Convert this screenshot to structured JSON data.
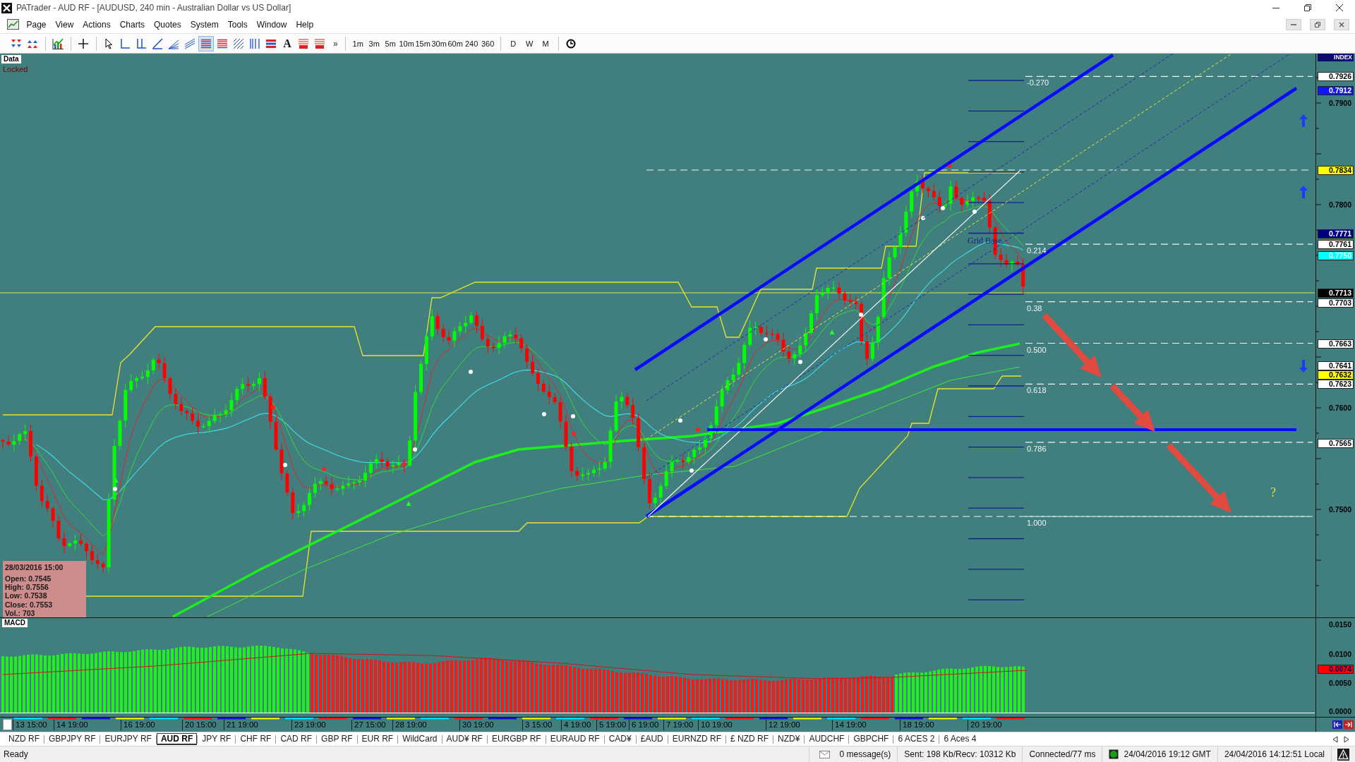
{
  "window": {
    "title": "PATrader - AUD RF - [AUDUSD, 240 min - Australian Dollar vs US Dollar]"
  },
  "menu": [
    "Page",
    "View",
    "Actions",
    "Charts",
    "Quotes",
    "System",
    "Tools",
    "Window",
    "Help"
  ],
  "toolbar": {
    "tool_groups": [
      [
        {
          "kind": "scroll-down",
          "selected": false
        },
        {
          "kind": "scroll-up",
          "selected": false
        }
      ],
      [
        {
          "kind": "indicators",
          "selected": false
        }
      ],
      [
        {
          "kind": "crosshair",
          "selected": false
        }
      ],
      [
        {
          "kind": "cursor",
          "selected": false
        },
        {
          "kind": "angle",
          "selected": false
        },
        {
          "kind": "double-angle",
          "selected": false
        },
        {
          "kind": "trendline",
          "selected": false
        },
        {
          "kind": "fan",
          "selected": false
        },
        {
          "kind": "parallel",
          "selected": false
        },
        {
          "kind": "fib-levels",
          "selected": true
        },
        {
          "kind": "levels",
          "selected": false
        },
        {
          "kind": "hatch",
          "selected": false
        },
        {
          "kind": "vertical",
          "selected": false
        },
        {
          "kind": "stripes",
          "selected": false
        },
        {
          "kind": "text",
          "label": "A",
          "selected": false
        },
        {
          "kind": "tagged-lines",
          "selected": false
        },
        {
          "kind": "tagged-lines",
          "selected": false
        }
      ]
    ],
    "overflow": "»",
    "periods": [
      "1m",
      "3m",
      "5m",
      "10m",
      "15m",
      "30m",
      "60m",
      "240",
      "360"
    ],
    "chart_periods": [
      "D",
      "W",
      "M"
    ]
  },
  "chart": {
    "data_label": "Data",
    "lock_status": "Locked",
    "price_axis": {
      "header": "INDEX",
      "labels": [
        {
          "text": "0.7926",
          "kind": "marker",
          "color": "#ffffff",
          "light_text": false
        },
        {
          "text": "0.7912",
          "kind": "marker",
          "color": "#1414ff",
          "light_text": true
        },
        {
          "text": "0.7900",
          "kind": "tick"
        },
        {
          "text": "0.7834",
          "kind": "marker",
          "color": "#ffff00",
          "light_text": false
        },
        {
          "text": "0.7800",
          "kind": "tick"
        },
        {
          "text": "0.7771",
          "kind": "marker",
          "color": "#000080",
          "light_text": true
        },
        {
          "text": "0.7761",
          "kind": "marker",
          "color": "#ffffff",
          "light_text": false
        },
        {
          "text": "0.7750",
          "kind": "marker",
          "color": "#00ffff",
          "light_text": true
        },
        {
          "text": "0.7713",
          "kind": "marker",
          "color": "#000000",
          "light_text": true
        },
        {
          "text": "0.7703",
          "kind": "marker",
          "color": "#ffffff",
          "light_text": false
        },
        {
          "text": "0.7663",
          "kind": "marker",
          "color": "#ffffff",
          "light_text": false
        },
        {
          "text": "0.7641",
          "kind": "marker",
          "color": "#ffffff",
          "light_text": false
        },
        {
          "text": "0.7632",
          "kind": "marker",
          "color": "#ffff00",
          "light_text": false
        },
        {
          "text": "0.7623",
          "kind": "marker",
          "color": "#ffffff",
          "light_text": false
        },
        {
          "text": "0.7600",
          "kind": "tick"
        },
        {
          "text": "0.7565",
          "kind": "marker",
          "color": "#ffffff",
          "light_text": false
        },
        {
          "text": "0.7500",
          "kind": "tick"
        }
      ]
    },
    "fibonacci_labels": [
      "-0.270",
      "0.214",
      "0.38",
      "0.500",
      "0.618",
      "0.786",
      "1.000"
    ],
    "grid_label": "Grid Base",
    "annotation": "?",
    "signal_arrows": [
      {
        "kind": "up"
      },
      {
        "kind": "up"
      },
      {
        "kind": "down"
      }
    ],
    "info_box": {
      "title": "28/03/2016 15:00",
      "lines": [
        "Open: 0.7545",
        "High: 0.7556",
        "Low: 0.7538",
        "Close: 0.7553",
        "Vol.: 703"
      ]
    }
  },
  "macd": {
    "label": "MACD",
    "axis_labels": [
      {
        "text": "0.0150",
        "kind": "tick"
      },
      {
        "text": "0.0100",
        "kind": "tick"
      },
      {
        "text": "0.0074",
        "kind": "marker",
        "color": "#ff0000",
        "light_text": false
      },
      {
        "text": "0.0050",
        "kind": "tick"
      },
      {
        "text": "0.0000",
        "kind": "tick"
      }
    ]
  },
  "time_axis": {
    "labels": [
      "13 15:00",
      "14 19:00",
      "16 19:00",
      "20 15:00",
      "21 19:00",
      "23 19:00",
      "27 15:00",
      "28 19:00",
      "30 19:00",
      "3 15:00",
      "4 19:00",
      "5 19:00",
      "6 19:00",
      "7 19:00",
      "10 19:00",
      "12 19:00",
      "14 19:00",
      "18 19:00",
      "20 19:00"
    ]
  },
  "tabs": [
    {
      "label": "NZD RF",
      "selected": false
    },
    {
      "label": "GBPJPY RF",
      "selected": false
    },
    {
      "label": "EURJPY RF",
      "selected": false
    },
    {
      "label": "AUD RF",
      "selected": true
    },
    {
      "label": "JPY RF",
      "selected": false
    },
    {
      "label": "CHF RF",
      "selected": false
    },
    {
      "label": "CAD RF",
      "selected": false
    },
    {
      "label": "GBP RF",
      "selected": false
    },
    {
      "label": "EUR RF",
      "selected": false
    },
    {
      "label": "WildCard",
      "selected": false
    },
    {
      "label": "AUD¥ RF",
      "selected": false
    },
    {
      "label": "EURGBP RF",
      "selected": false
    },
    {
      "label": "EURAUD RF",
      "selected": false
    },
    {
      "label": "CAD¥",
      "selected": false
    },
    {
      "label": "£AUD",
      "selected": false
    },
    {
      "label": "EURNZD RF",
      "selected": false
    },
    {
      "label": "£ NZD RF",
      "selected": false
    },
    {
      "label": "NZD¥",
      "selected": false
    },
    {
      "label": "AUDCHF",
      "selected": false
    },
    {
      "label": "GBPCHF",
      "selected": false
    },
    {
      "label": "6 ACES 2",
      "selected": false
    },
    {
      "label": "6 Aces 4",
      "selected": false
    }
  ],
  "status_bar": {
    "ready": "Ready",
    "messages": "0 message(s)",
    "traffic": "Sent: 198 Kb/Recv: 10312 Kb",
    "connection": "Connected/77 ms",
    "online": true,
    "gmt_time": "24/04/2016 19:12 GMT",
    "local_time": "24/04/2016 14:12:51 Local"
  }
}
